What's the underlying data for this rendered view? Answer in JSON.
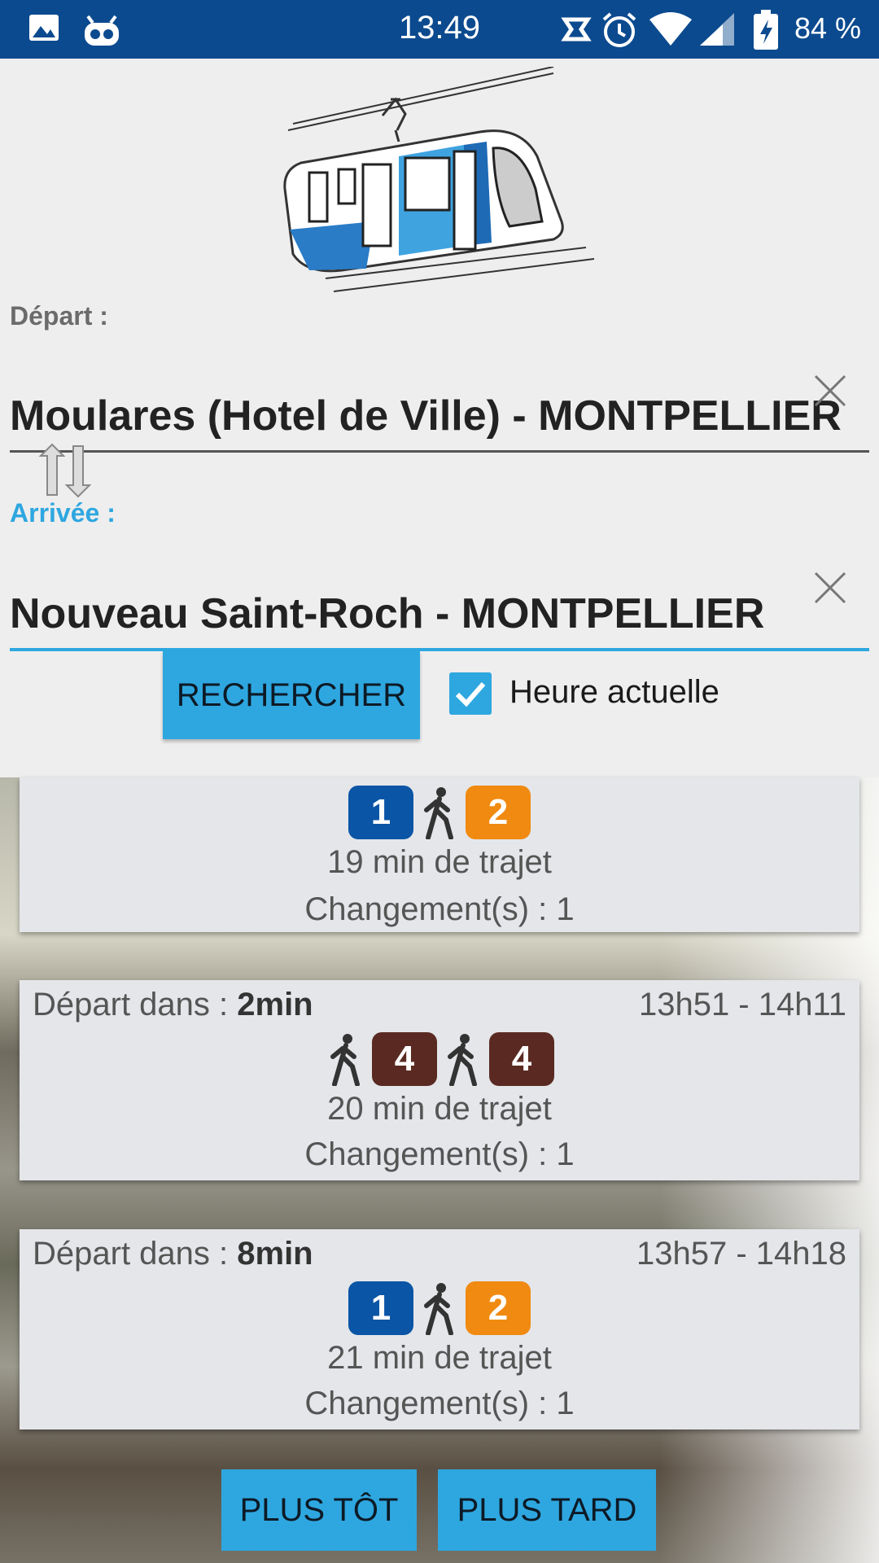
{
  "status_bar": {
    "time": "13:49",
    "battery": "84 %",
    "icons": [
      "image-icon",
      "robot-icon",
      "sync-icon",
      "alarm-icon",
      "wifi-icon",
      "signal-icon",
      "battery-charging-icon"
    ]
  },
  "search": {
    "depart_label": "Départ :",
    "depart_value": "Moulares (Hotel de Ville) - MONTPELLIER",
    "arrivee_label": "Arrivée :",
    "arrivee_value": "Nouveau Saint-Roch - MONTPELLIER",
    "search_button": "RECHERCHER",
    "current_time_label": "Heure actuelle",
    "current_time_checked": true
  },
  "colors": {
    "accent": "#2ea7e0",
    "statusbar": "#0b4a8f",
    "line1": "#0a55a5",
    "line2": "#f08a10",
    "line4": "#5a2a22"
  },
  "results": [
    {
      "depart_prefix": "",
      "depart_minutes": "",
      "time_range": "",
      "segments": [
        {
          "type": "line",
          "label": "1",
          "color": "#0a55a5"
        },
        {
          "type": "walk"
        },
        {
          "type": "line",
          "label": "2",
          "color": "#f08a10"
        }
      ],
      "duration": "19 min de trajet",
      "changes": "Changement(s) : 1"
    },
    {
      "depart_prefix": "Départ dans : ",
      "depart_minutes": "2min",
      "time_range": "13h51 - 14h11",
      "segments": [
        {
          "type": "walk"
        },
        {
          "type": "line",
          "label": "4",
          "color": "#5a2a22"
        },
        {
          "type": "walk"
        },
        {
          "type": "line",
          "label": "4",
          "color": "#5a2a22"
        }
      ],
      "duration": "20 min de trajet",
      "changes": "Changement(s) : 1"
    },
    {
      "depart_prefix": "Départ dans : ",
      "depart_minutes": "8min",
      "time_range": "13h57 - 14h18",
      "segments": [
        {
          "type": "line",
          "label": "1",
          "color": "#0a55a5"
        },
        {
          "type": "walk"
        },
        {
          "type": "line",
          "label": "2",
          "color": "#f08a10"
        }
      ],
      "duration": "21 min de trajet",
      "changes": "Changement(s) : 1"
    }
  ],
  "pagination": {
    "earlier": "PLUS TÔT",
    "later": "PLUS TARD"
  }
}
